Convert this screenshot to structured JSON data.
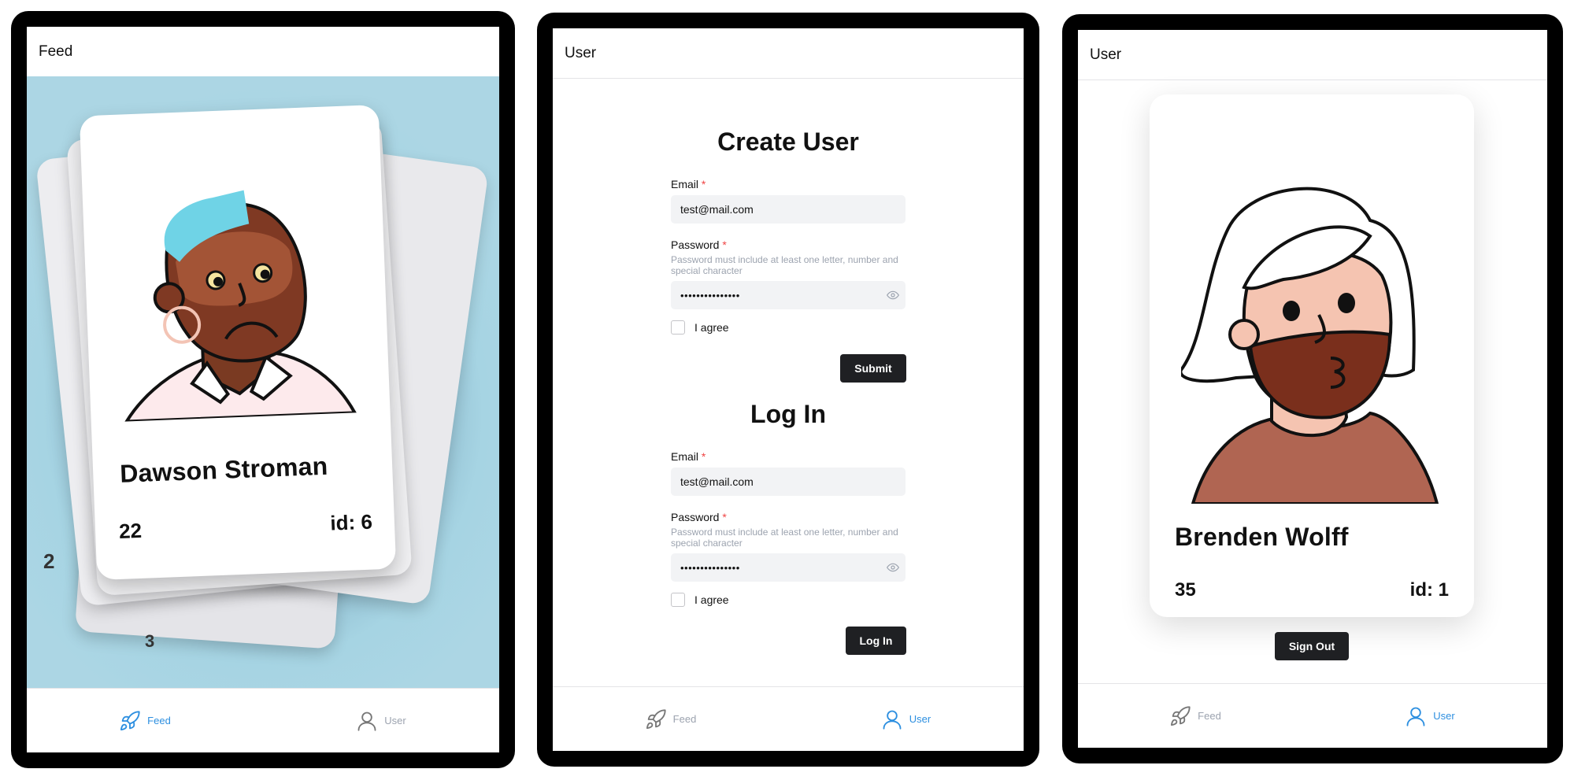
{
  "feed_screen": {
    "title": "Feed",
    "card": {
      "name": "Dawson Stroman",
      "age": "22",
      "id_label": "id: 6"
    },
    "stack_partial_1": "2",
    "stack_partial_2": "3",
    "tabs": [
      {
        "label": "Feed",
        "icon": "rocket-icon",
        "active": true
      },
      {
        "label": "User",
        "icon": "user-icon",
        "active": false
      }
    ]
  },
  "user_screen": {
    "title": "User",
    "create": {
      "heading": "Create User",
      "email_label": "Email",
      "email_value": "test@mail.com",
      "password_label": "Password",
      "password_hint": "Password must include at least one letter, number and special character",
      "password_value": "•••••••••••••••",
      "agree_label": "I agree",
      "submit_label": "Submit"
    },
    "login": {
      "heading": "Log In",
      "email_label": "Email",
      "email_value": "test@mail.com",
      "password_label": "Password",
      "password_hint": "Password must include at least one letter, number and special character",
      "password_value": "•••••••••••••••",
      "agree_label": "I agree",
      "submit_label": "Log In"
    },
    "required_mark": "*",
    "tabs": [
      {
        "label": "Feed",
        "icon": "rocket-icon",
        "active": false
      },
      {
        "label": "User",
        "icon": "user-icon",
        "active": true
      }
    ]
  },
  "profile_screen": {
    "title": "User",
    "card": {
      "name": "Brenden Wolff",
      "age": "35",
      "id_label": "id: 1"
    },
    "signout_label": "Sign Out",
    "tabs": [
      {
        "label": "Feed",
        "icon": "rocket-icon",
        "active": false
      },
      {
        "label": "User",
        "icon": "user-icon",
        "active": true
      }
    ]
  },
  "colors": {
    "accent": "#2d8fe0",
    "inactive": "#9ca3af",
    "button": "#1f2023",
    "feed_background": "#acd6e4",
    "required": "#ef4444"
  }
}
